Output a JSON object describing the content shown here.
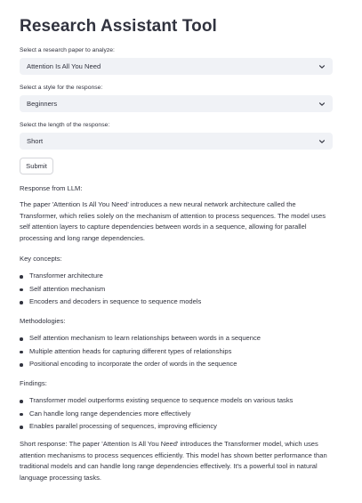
{
  "title": "Research Assistant Tool",
  "paper_select": {
    "label": "Select a research paper to analyze:",
    "value": "Attention Is All You Need",
    "icon": "chevron-down-icon"
  },
  "style_select": {
    "label": "Select a style for the response:",
    "value": "Beginners",
    "icon": "chevron-down-icon"
  },
  "length_select": {
    "label": "Select the length of the response:",
    "value": "Short",
    "icon": "chevron-down-icon"
  },
  "submit_label": "Submit",
  "response": {
    "heading": "Response from LLM:",
    "intro": "The paper 'Attention Is All You Need' introduces a new neural network architecture called the Transformer, which relies solely on the mechanism of attention to process sequences. The model uses self attention layers to capture dependencies between words in a sequence, allowing for parallel processing and long range dependencies.",
    "key_concepts": {
      "heading": "Key concepts:",
      "items": [
        "Transformer architecture",
        "Self attention mechanism",
        "Encoders and decoders in sequence to sequence models"
      ]
    },
    "methodologies": {
      "heading": "Methodologies:",
      "items": [
        "Self attention mechanism to learn relationships between words in a sequence",
        "Multiple attention heads for capturing different types of relationships",
        "Positional encoding to incorporate the order of words in the sequence"
      ]
    },
    "findings": {
      "heading": "Findings:",
      "items": [
        "Transformer model outperforms existing sequence to sequence models on various tasks",
        "Can handle long range dependencies more effectively",
        "Enables parallel processing of sequences, improving efficiency"
      ]
    },
    "short_response": "Short response: The paper 'Attention Is All You Need' introduces the Transformer model, which uses attention mechanisms to process sequences efficiently. This model has shown better performance than traditional models and can handle long range dependencies effectively. It's a powerful tool in natural language processing tasks."
  }
}
